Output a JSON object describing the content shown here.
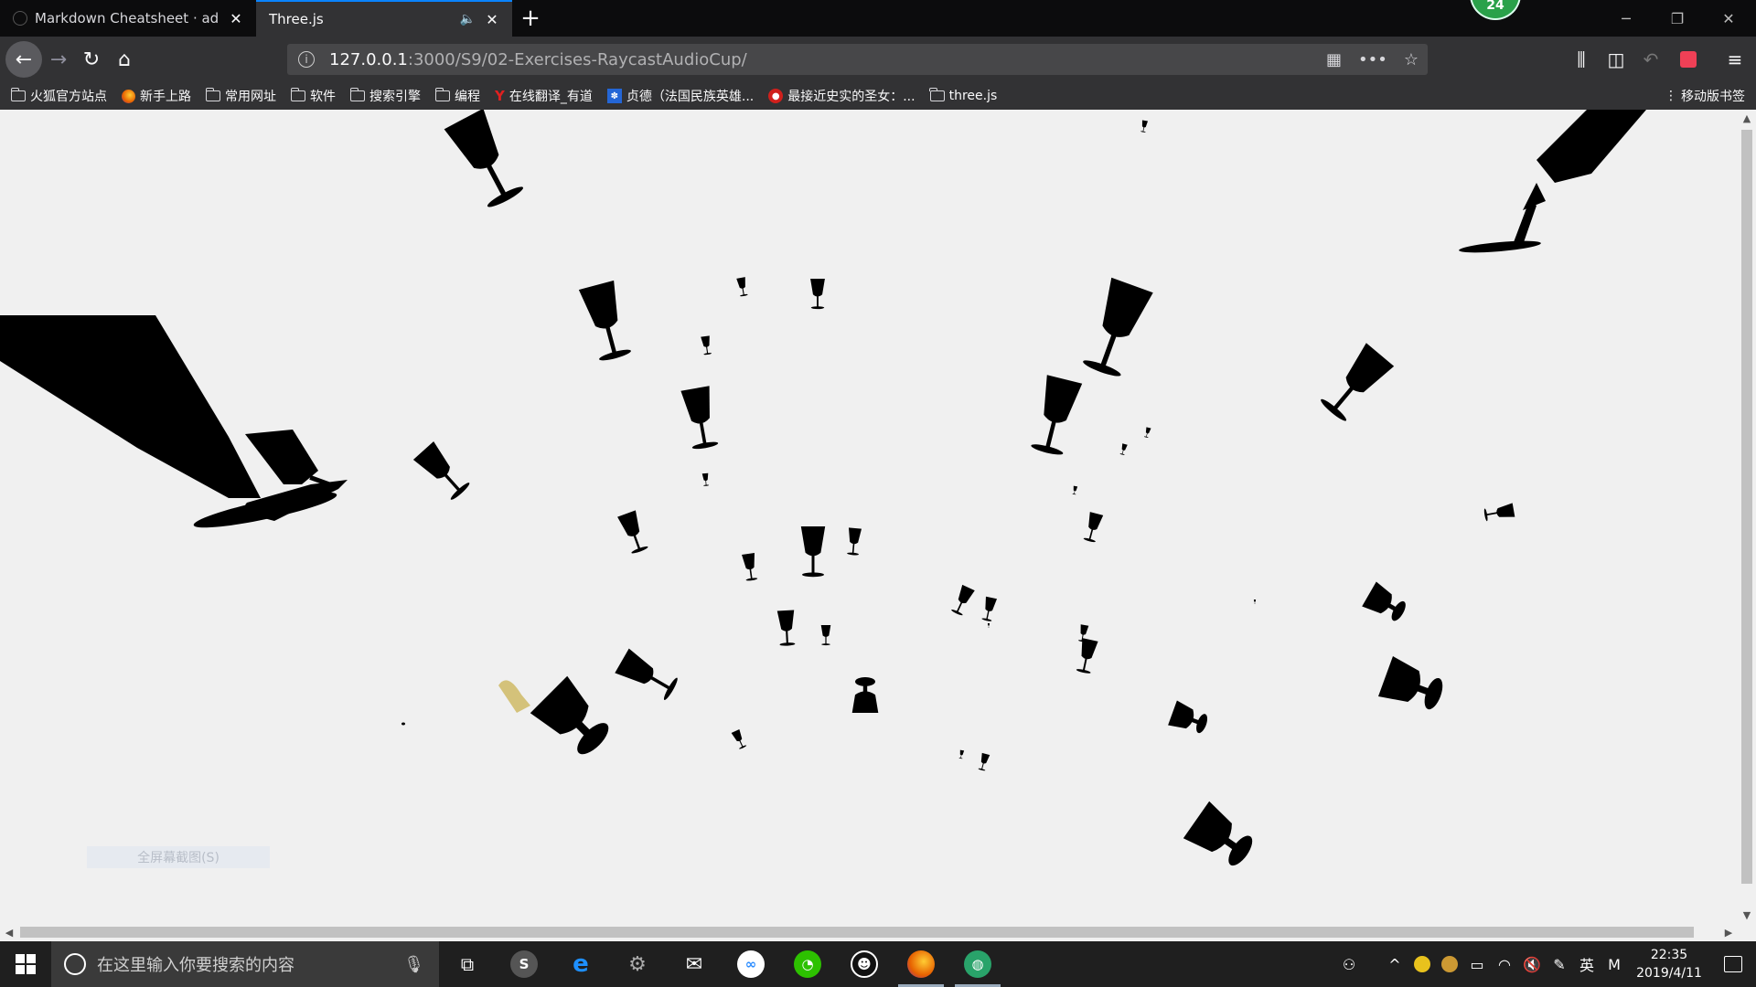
{
  "tabs": [
    {
      "title": "Markdown Cheatsheet · adam-p/markdown-here Wiki",
      "active": false
    },
    {
      "title": "Three.js",
      "active": true,
      "audio": true
    }
  ],
  "badge": {
    "count": "24"
  },
  "nav": {
    "url_host": "127.0.0.1",
    "url_path": ":3000/S9/02-Exercises-RaycastAudioCup/"
  },
  "bookmarks": [
    {
      "label": "火狐官方站点",
      "icon": "folder-icon"
    },
    {
      "label": "新手上路",
      "icon": "firefox-icon"
    },
    {
      "label": "常用网址",
      "icon": "folder-icon"
    },
    {
      "label": "软件",
      "icon": "folder-icon"
    },
    {
      "label": "搜索引擎",
      "icon": "folder-icon"
    },
    {
      "label": "编程",
      "icon": "folder-icon"
    },
    {
      "label": "在线翻译_有道",
      "icon": "youdao-icon"
    },
    {
      "label": "贞德（法国民族英雄...",
      "icon": "baidu-paw-icon"
    },
    {
      "label": "最接近史实的圣女：...",
      "icon": "weibo-icon"
    },
    {
      "label": "three.js",
      "icon": "folder-icon"
    }
  ],
  "mobile_bookmarks": "移动版书签",
  "content": {
    "ghost_label": "全屏幕截图(S)"
  },
  "taskbar": {
    "search_placeholder": "在这里输入你要搜索的内容",
    "apps": [
      {
        "name": "task-view"
      },
      {
        "name": "app-swirl"
      },
      {
        "name": "internet-explorer"
      },
      {
        "name": "app-settings-gear"
      },
      {
        "name": "mail"
      },
      {
        "name": "baidu-netdisk"
      },
      {
        "name": "wechat"
      },
      {
        "name": "qq"
      },
      {
        "name": "firefox"
      },
      {
        "name": "app-green-globe"
      }
    ],
    "ime": "英",
    "ime_mode": "M",
    "time": "22:35",
    "date": "2019/4/11"
  },
  "colors": {
    "accent": "#0a84ff",
    "chrome_dark": "#0c0c0d",
    "toolbar": "#323234",
    "urlbar": "#474749",
    "canvas_bg": "#f0f0f0",
    "cup": "#000000",
    "taskbar": "#1f1f1f",
    "badge": "#2aa14a"
  }
}
